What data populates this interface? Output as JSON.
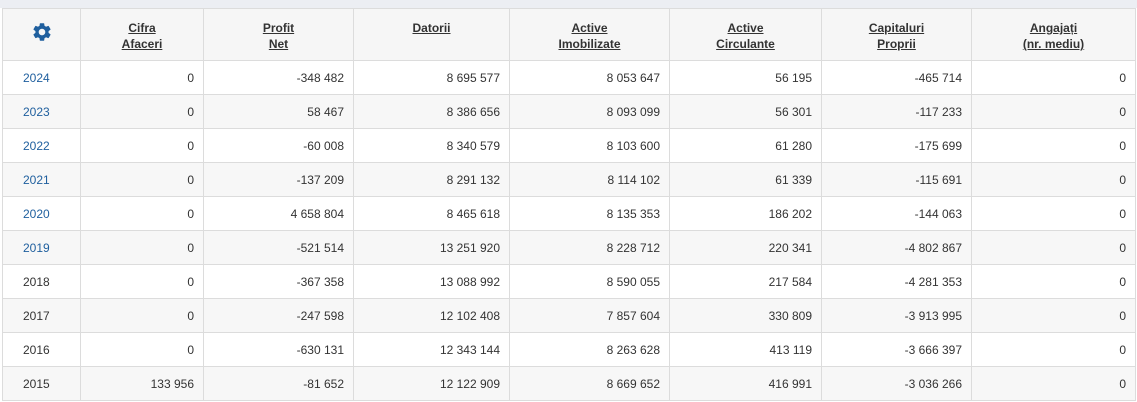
{
  "header": {
    "settings_icon": "gear-icon",
    "settings_color": "#1f5f9e",
    "columns": [
      {
        "line1": "Cifra",
        "line2": "Afaceri"
      },
      {
        "line1": "Profit",
        "line2": "Net"
      },
      {
        "line1": "Datorii",
        "line2": ""
      },
      {
        "line1": "Active",
        "line2": "Imobilizate"
      },
      {
        "line1": "Active",
        "line2": "Circulante"
      },
      {
        "line1": "Capitaluri",
        "line2": "Proprii"
      },
      {
        "line1": "Angajați",
        "line2": "(nr. mediu)"
      }
    ]
  },
  "rows": [
    {
      "year": "2024",
      "link": true,
      "cifra_afaceri": "0",
      "profit_net": "-348 482",
      "datorii": "8 695 577",
      "active_imobilizate": "8 053 647",
      "active_circulante": "56 195",
      "capitaluri_proprii": "-465 714",
      "angajati": "0"
    },
    {
      "year": "2023",
      "link": true,
      "cifra_afaceri": "0",
      "profit_net": "58 467",
      "datorii": "8 386 656",
      "active_imobilizate": "8 093 099",
      "active_circulante": "56 301",
      "capitaluri_proprii": "-117 233",
      "angajati": "0"
    },
    {
      "year": "2022",
      "link": true,
      "cifra_afaceri": "0",
      "profit_net": "-60 008",
      "datorii": "8 340 579",
      "active_imobilizate": "8 103 600",
      "active_circulante": "61 280",
      "capitaluri_proprii": "-175 699",
      "angajati": "0"
    },
    {
      "year": "2021",
      "link": true,
      "cifra_afaceri": "0",
      "profit_net": "-137 209",
      "datorii": "8 291 132",
      "active_imobilizate": "8 114 102",
      "active_circulante": "61 339",
      "capitaluri_proprii": "-115 691",
      "angajati": "0"
    },
    {
      "year": "2020",
      "link": true,
      "cifra_afaceri": "0",
      "profit_net": "4 658 804",
      "datorii": "8 465 618",
      "active_imobilizate": "8 135 353",
      "active_circulante": "186 202",
      "capitaluri_proprii": "-144 063",
      "angajati": "0"
    },
    {
      "year": "2019",
      "link": true,
      "cifra_afaceri": "0",
      "profit_net": "-521 514",
      "datorii": "13 251 920",
      "active_imobilizate": "8 228 712",
      "active_circulante": "220 341",
      "capitaluri_proprii": "-4 802 867",
      "angajati": "0"
    },
    {
      "year": "2018",
      "link": false,
      "cifra_afaceri": "0",
      "profit_net": "-367 358",
      "datorii": "13 088 992",
      "active_imobilizate": "8 590 055",
      "active_circulante": "217 584",
      "capitaluri_proprii": "-4 281 353",
      "angajati": "0"
    },
    {
      "year": "2017",
      "link": false,
      "cifra_afaceri": "0",
      "profit_net": "-247 598",
      "datorii": "12 102 408",
      "active_imobilizate": "7 857 604",
      "active_circulante": "330 809",
      "capitaluri_proprii": "-3 913 995",
      "angajati": "0"
    },
    {
      "year": "2016",
      "link": false,
      "cifra_afaceri": "0",
      "profit_net": "-630 131",
      "datorii": "12 343 144",
      "active_imobilizate": "8 263 628",
      "active_circulante": "413 119",
      "capitaluri_proprii": "-3 666 397",
      "angajati": "0"
    },
    {
      "year": "2015",
      "link": false,
      "cifra_afaceri": "133 956",
      "profit_net": "-81 652",
      "datorii": "12 122 909",
      "active_imobilizate": "8 669 652",
      "active_circulante": "416 991",
      "capitaluri_proprii": "-3 036 266",
      "angajati": "0"
    }
  ]
}
